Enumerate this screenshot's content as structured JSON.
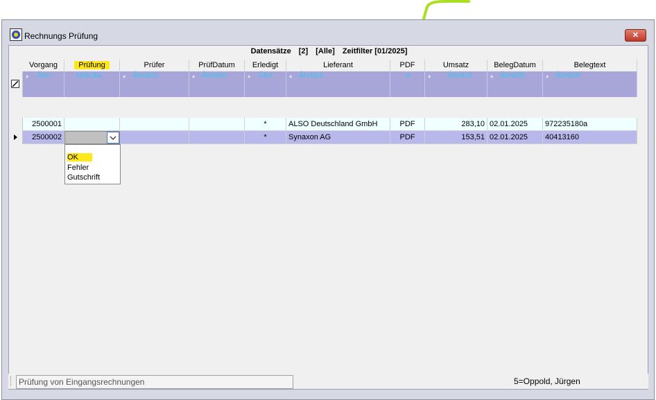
{
  "window": {
    "title": "Rechnungs Prüfung",
    "close_label": "✕"
  },
  "grid": {
    "info_parts": [
      "Datensätze",
      "[2]",
      "[Alle]",
      "Zeitfilter [01/2025]"
    ],
    "columns": [
      {
        "label": "Vorgang",
        "filter_op": "*",
        "filter_value": "Ähn"
      },
      {
        "label": "Prüfung",
        "filter_op": "",
        "filter_value": "NotLike"
      },
      {
        "label": "Prüfer",
        "filter_op": "*",
        "filter_value": "Ähnlich"
      },
      {
        "label": "PrüfDatum",
        "filter_op": "*",
        "filter_value": "Ähnlich"
      },
      {
        "label": "Erledigt",
        "filter_op": "*",
        "filter_value": "Ähn"
      },
      {
        "label": "Lieferant",
        "filter_op": "*",
        "filter_value": "Ähnlich"
      },
      {
        "label": "PDF",
        "filter_op": "",
        "filter_value": "A"
      },
      {
        "label": "Umsatz",
        "filter_op": "*",
        "filter_value": "Ähnlich"
      },
      {
        "label": "BelegDatum",
        "filter_op": "*",
        "filter_value": "Ähnlich"
      },
      {
        "label": "Belegtext",
        "filter_op": "*",
        "filter_value": "Ähnlich"
      }
    ],
    "rows": [
      {
        "vorgang": "2500001",
        "pruefung": "",
        "pruefer": "",
        "pruefdatum": "",
        "erledigt": "*",
        "lieferant": "ALSO Deutschland GmbH",
        "pdf": "PDF",
        "umsatz": "283,10",
        "belegdatum": "02.01.2025",
        "belegtext": "972235180a"
      },
      {
        "vorgang": "2500002",
        "pruefung": "",
        "pruefer": "",
        "pruefdatum": "",
        "erledigt": "*",
        "lieferant": "Synaxon AG",
        "pdf": "PDF",
        "umsatz": "153,51",
        "belegdatum": "02.01.2025",
        "belegtext": "40413160"
      }
    ]
  },
  "dropdown": {
    "options": [
      "OK",
      "Fehler",
      "Gutschrift"
    ],
    "highlighted": "OK"
  },
  "status": {
    "message": "Prüfung von Eingangsrechnungen",
    "user": "5=Oppold, Jürgen"
  },
  "colors": {
    "highlight": "#ffe81a",
    "filter_row": "#a8a6d8",
    "selected_row": "#b8b8ec",
    "annotation_arrow": "#a8e020"
  }
}
